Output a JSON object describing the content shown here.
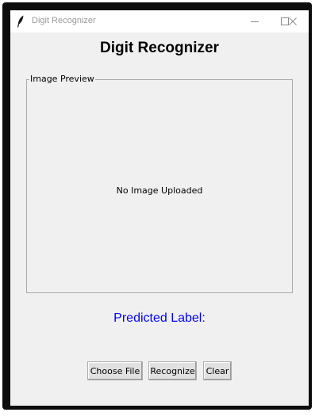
{
  "window": {
    "title": "Digit Recognizer",
    "icon": "feather-icon",
    "controls": [
      "minimize-icon",
      "maximize-icon",
      "close-icon"
    ]
  },
  "heading": "Digit Recognizer",
  "preview": {
    "group_label": "Image Preview",
    "placeholder": "No Image Uploaded"
  },
  "prediction": {
    "label": "Predicted Label:",
    "color": "#0000ff"
  },
  "buttons": {
    "choose_file": "Choose File",
    "recognize": "Recognize",
    "clear": "Clear"
  }
}
